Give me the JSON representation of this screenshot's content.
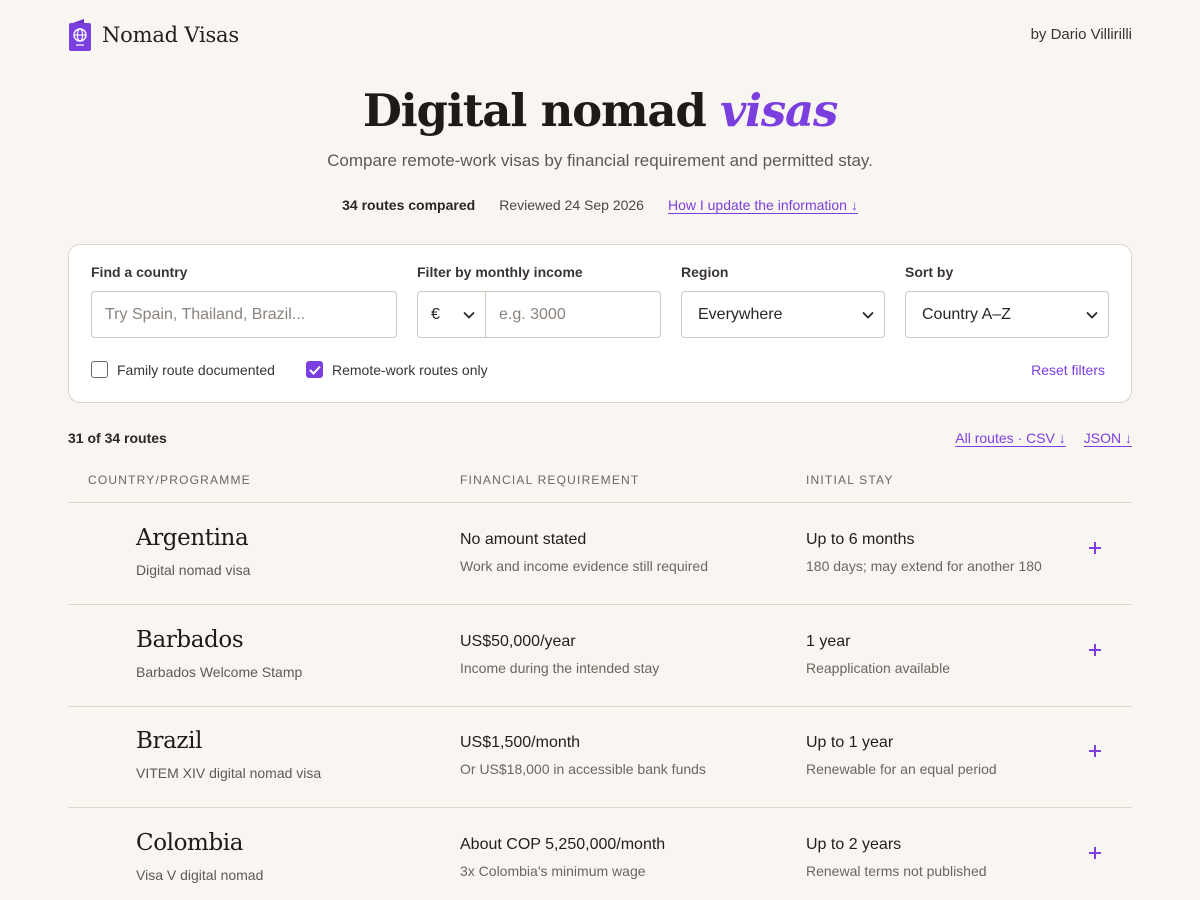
{
  "brand": {
    "name": "Nomad Visas",
    "logo_icon": "passport-globe-icon"
  },
  "byline": "by Dario Villirilli",
  "hero": {
    "title_main": "Digital nomad",
    "title_accent": "visas",
    "subtitle": "Compare remote-work visas by financial requirement and permitted stay."
  },
  "meta": {
    "routes_compared": "34 routes compared",
    "reviewed": "Reviewed 24 Sep 2026",
    "update_link": "How I update the information ↓"
  },
  "filters": {
    "country_label": "Find a country",
    "country_placeholder": "Try Spain, Thailand, Brazil...",
    "income_label": "Filter by monthly income",
    "currency": "€",
    "income_placeholder": "e.g. 3000",
    "region_label": "Region",
    "region_value": "Everywhere",
    "sort_label": "Sort by",
    "sort_value": "Country A–Z",
    "family_label": "Family route documented",
    "family_checked": false,
    "remote_label": "Remote-work routes only",
    "remote_checked": true,
    "reset": "Reset filters"
  },
  "results": {
    "count": "31 of 34 routes",
    "csv_link": "All routes · CSV ↓",
    "json_link": "JSON ↓"
  },
  "table": {
    "headers": [
      "COUNTRY/PROGRAMME",
      "FINANCIAL REQUIREMENT",
      "INITIAL STAY"
    ],
    "rows": [
      {
        "country": "Argentina",
        "programme": "Digital nomad visa",
        "requirement": "No amount stated",
        "requirement_note": "Work and income evidence still required",
        "stay": "Up to 6 months",
        "stay_note": "180 days; may extend for another 180"
      },
      {
        "country": "Barbados",
        "programme": "Barbados Welcome Stamp",
        "requirement": "US$50,000/year",
        "requirement_note": "Income during the intended stay",
        "stay": "1 year",
        "stay_note": "Reapplication available"
      },
      {
        "country": "Brazil",
        "programme": "VITEM XIV digital nomad visa",
        "requirement": "US$1,500/month",
        "requirement_note": "Or US$18,000 in accessible bank funds",
        "stay": "Up to 1 year",
        "stay_note": "Renewable for an equal period"
      },
      {
        "country": "Colombia",
        "programme": "Visa V digital nomad",
        "requirement": "About COP 5,250,000/month",
        "requirement_note": "3x Colombia's minimum wage",
        "stay": "Up to 2 years",
        "stay_note": "Renewal terms not published"
      }
    ]
  },
  "colors": {
    "accent": "#7b3fe0",
    "background": "#f9f6f1",
    "border": "#ddd6cd"
  }
}
